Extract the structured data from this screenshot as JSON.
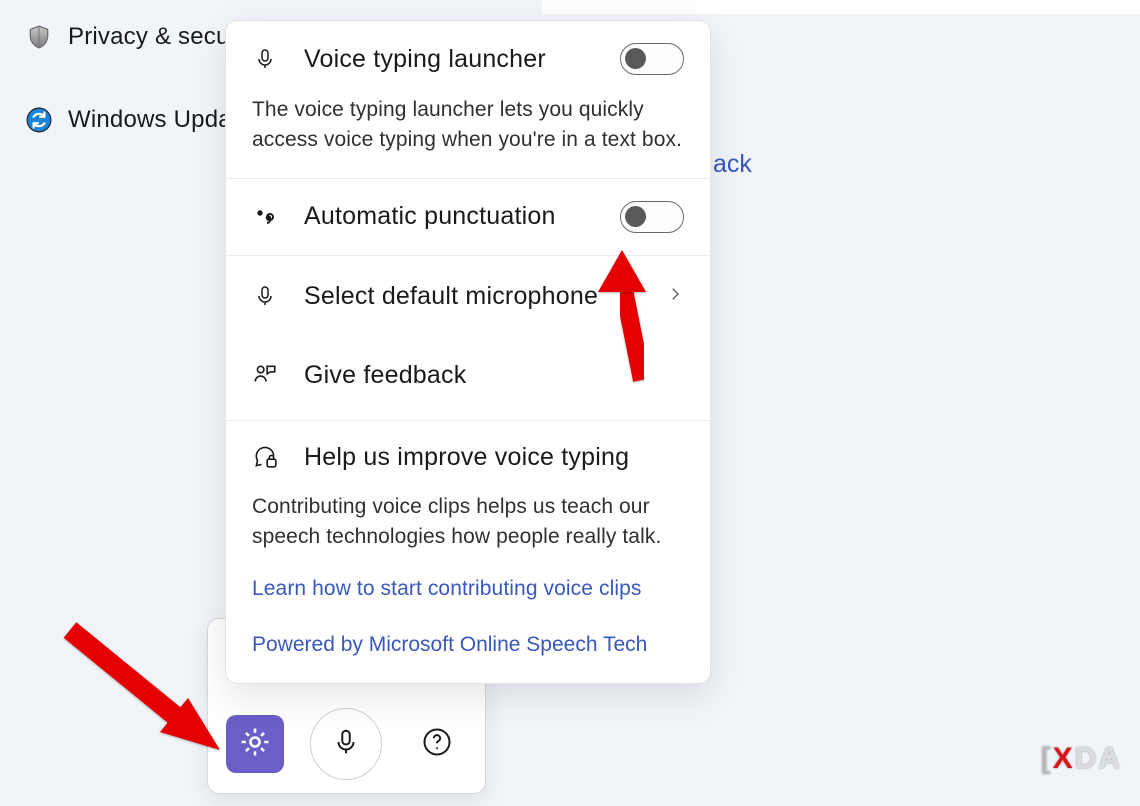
{
  "sidebar": {
    "privacy_label": "Privacy & security",
    "update_label": "Windows Update"
  },
  "background_link_partial": "ack",
  "popover": {
    "launcher": {
      "title": "Voice typing launcher",
      "desc": "The voice typing launcher lets you quickly access voice typing when you're in a text box."
    },
    "auto_punc": {
      "title": "Automatic punctuation"
    },
    "select_mic": {
      "title": "Select default microphone"
    },
    "feedback": {
      "title": "Give feedback"
    },
    "improve": {
      "title": "Help us improve voice typing",
      "desc": "Contributing voice clips helps us teach our speech technologies how people really talk.",
      "link": "Learn how to start contributing voice clips"
    },
    "footer": "Powered by Microsoft Online Speech Tech"
  },
  "watermark": {
    "x": "X",
    "da": "DA"
  }
}
